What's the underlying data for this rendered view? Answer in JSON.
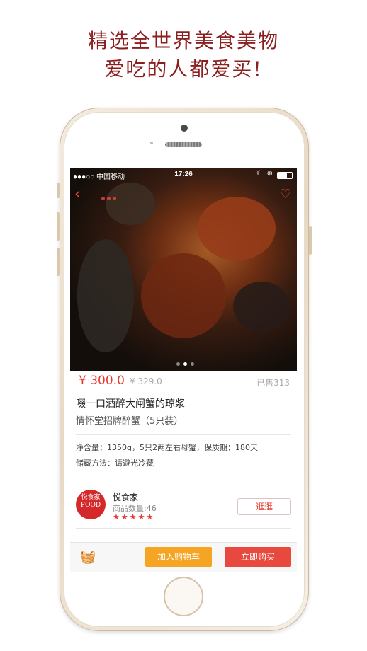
{
  "promo": {
    "line1": "精选全世界美食美物",
    "line2": "爱吃的人都爱买!"
  },
  "status_bar": {
    "carrier": "●●●○○ 中国移动",
    "time": "17:26"
  },
  "product": {
    "price": "¥ 300.0",
    "original_price": "¥ 329.0",
    "sold": "已售313",
    "title": "啜一口酒醉大闸蟹的琼浆",
    "subtitle": "情怀堂招牌醉蟹（5只装）",
    "spec_line": "净含量：1350g，5只2两左右母蟹，保质期：180天",
    "storage_line": "储藏方法：请避光冷藏",
    "image_pages": 3,
    "image_active_page": 2
  },
  "shop": {
    "logo_text_line1": "悦食家",
    "logo_text_line2": "FOOD",
    "name": "悦食家",
    "goods_count": "商品数量:46",
    "rating_stars": "★★★★★",
    "visit_label": "逛逛"
  },
  "actions": {
    "add_to_cart": "加入购物车",
    "buy_now": "立即购买"
  },
  "colors": {
    "accent": "#e8493f",
    "cart_button": "#f5a523",
    "headline": "#8a1f1f"
  }
}
